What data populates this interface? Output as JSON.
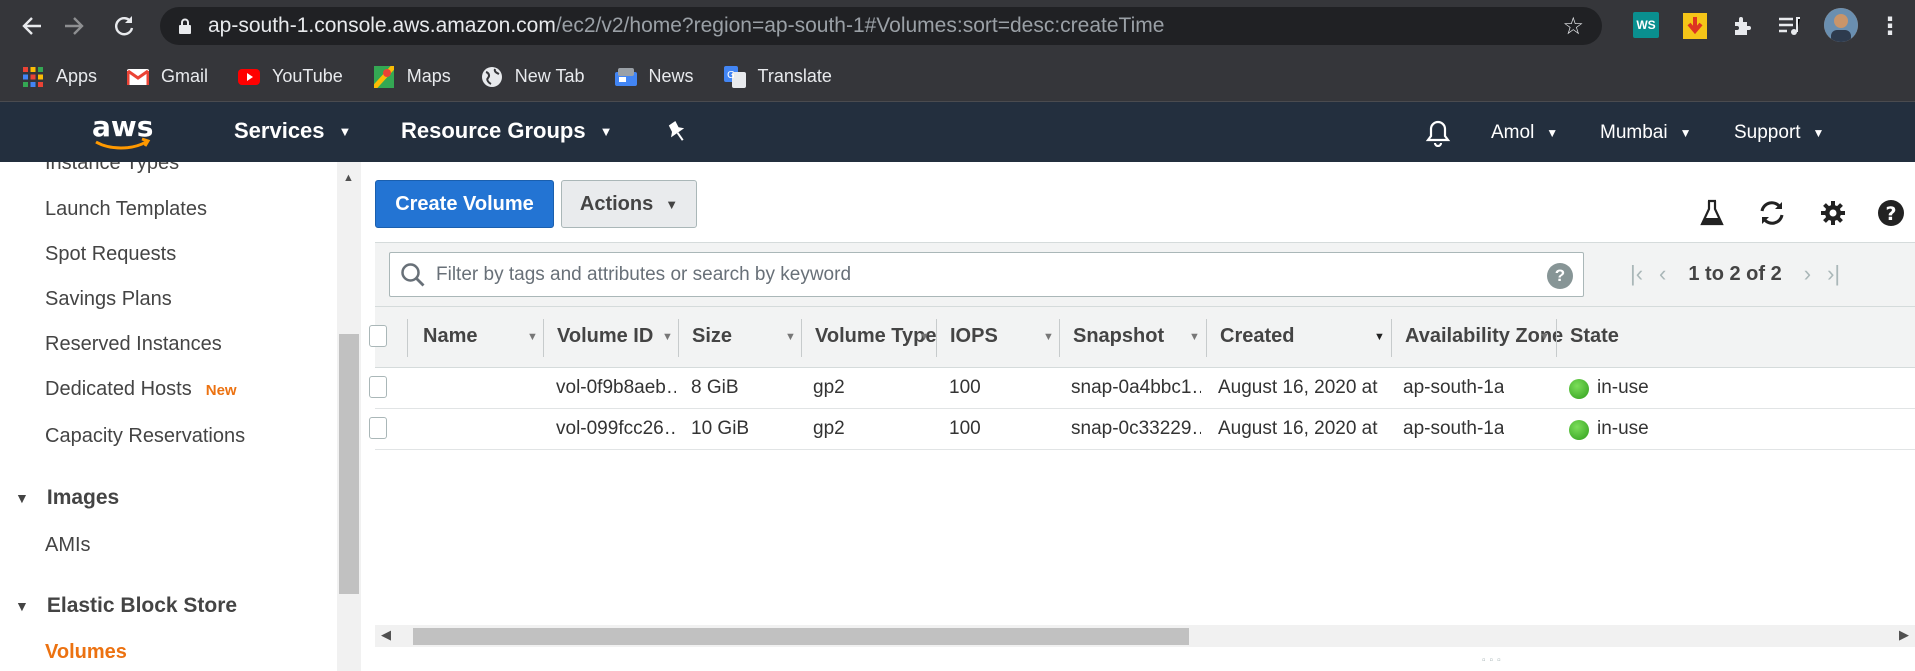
{
  "browser": {
    "url_host": "ap-south-1.console.aws.amazon.com",
    "url_path": "/ec2/v2/home?region=ap-south-1#Volumes:sort=desc:createTime",
    "bookmarks": [
      "Apps",
      "Gmail",
      "YouTube",
      "Maps",
      "New Tab",
      "News",
      "Translate"
    ],
    "ext_ws_label": "WS"
  },
  "aws_header": {
    "logo": "aws",
    "services": "Services",
    "resource_groups": "Resource Groups",
    "user": "Amol",
    "region": "Mumbai",
    "support": "Support"
  },
  "sidebar": {
    "items": [
      {
        "label": "Instance Types"
      },
      {
        "label": "Launch Templates"
      },
      {
        "label": "Spot Requests"
      },
      {
        "label": "Savings Plans"
      },
      {
        "label": "Reserved Instances"
      },
      {
        "label": "Dedicated Hosts",
        "badge": "New"
      },
      {
        "label": "Capacity Reservations"
      }
    ],
    "sections": [
      {
        "title": "Images",
        "items": [
          {
            "label": "AMIs"
          }
        ]
      },
      {
        "title": "Elastic Block Store",
        "items": [
          {
            "label": "Volumes",
            "active": true
          }
        ]
      }
    ]
  },
  "toolbar": {
    "create_label": "Create Volume",
    "actions_label": "Actions"
  },
  "filter": {
    "placeholder": "Filter by tags and attributes or search by keyword",
    "pagination": "1 to 2 of 2"
  },
  "table": {
    "columns": [
      "Name",
      "Volume ID",
      "Size",
      "Volume Type",
      "IOPS",
      "Snapshot",
      "Created",
      "Availability Zone",
      "State"
    ],
    "rows": [
      {
        "name": "",
        "volume_id": "vol-0f9b8aeb…",
        "size": "8 GiB",
        "type": "gp2",
        "iops": "100",
        "snapshot": "snap-0a4bbc1…",
        "created": "August 16, 2020 at …",
        "az": "ap-south-1a",
        "state": "in-use"
      },
      {
        "name": "",
        "volume_id": "vol-099fcc26…",
        "size": "10 GiB",
        "type": "gp2",
        "iops": "100",
        "snapshot": "snap-0c33229…",
        "created": "August 16, 2020 at …",
        "az": "ap-south-1a",
        "state": "in-use"
      }
    ]
  },
  "colors": {
    "aws_nav": "#232f3e",
    "primary_button": "#2374d3",
    "accent_orange": "#ec7211",
    "status_green": "#2f9e1c"
  }
}
